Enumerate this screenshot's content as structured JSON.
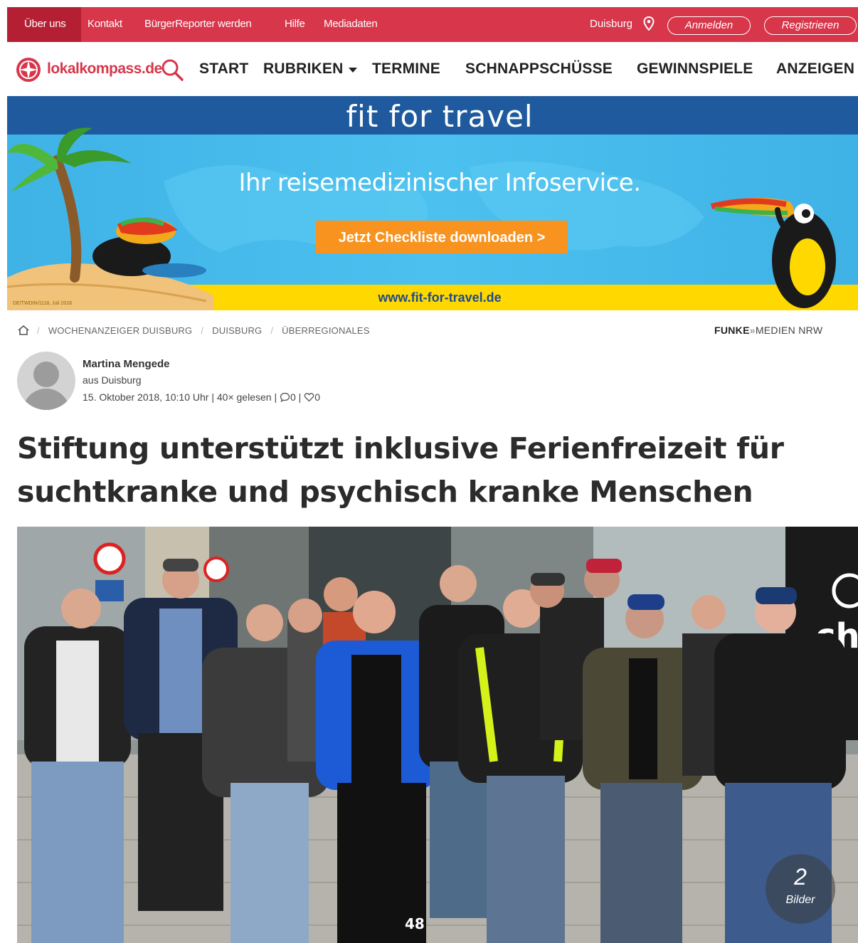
{
  "topbar": {
    "links": [
      "Über uns",
      "Kontakt",
      "BürgerReporter werden",
      "Hilfe",
      "Mediadaten"
    ],
    "location": "Duisburg",
    "login": "Anmelden",
    "register": "Registrieren"
  },
  "nav": {
    "brand": "lokalkompass.de",
    "items": [
      "START",
      "RUBRIKEN",
      "TERMINE",
      "SCHNAPPSCHÜSSE",
      "GEWINNSPIELE",
      "ANZEIGEN"
    ]
  },
  "ad": {
    "title": "fit for travel",
    "subtitle": "Ihr reisemedizinischer Infoservice.",
    "button": "Jetzt Checkliste downloaden  >",
    "url": "www.fit-for-travel.de",
    "code": "DE/TWDIN/1118, Juli 2018"
  },
  "breadcrumb": [
    "WOCHENANZEIGER DUISBURG",
    "DUISBURG",
    "ÜBERREGIONALES"
  ],
  "publisher": {
    "bold": "FUNKE",
    "rest": "MEDIEN NRW"
  },
  "author": {
    "name": "Martina Mengede",
    "from": "aus Duisburg",
    "date": "15. Oktober 2018, 10:10 Uhr",
    "reads": "40× gelesen",
    "comments": "0",
    "likes": "0"
  },
  "headline": "Stiftung unterstützt inklusive Ferienfreizeit für suchtkranke und psychisch kranke Menschen",
  "gallery": {
    "count": "2",
    "label": "Bilder"
  },
  "colors": {
    "brand": "#d7364b",
    "ad_blue": "#1f5a9e",
    "ad_button": "#f8931f",
    "ad_yellow": "#ffd800"
  },
  "icons": [
    "map-pin-icon",
    "search-icon",
    "home-icon",
    "comment-icon",
    "heart-icon",
    "logo-compass-icon"
  ]
}
